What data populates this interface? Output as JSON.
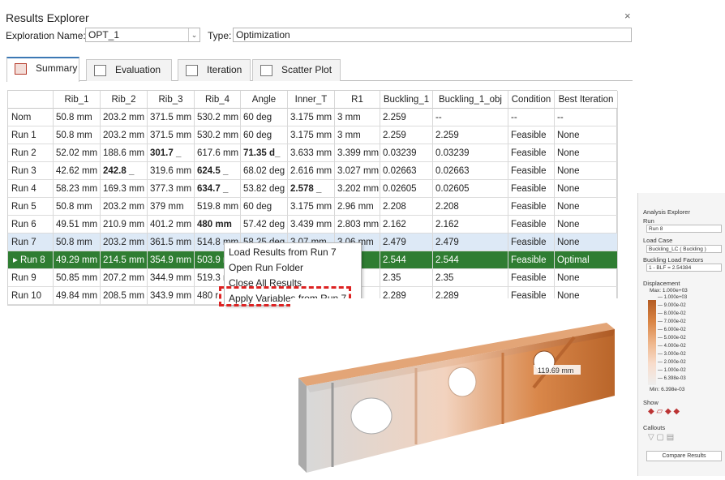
{
  "window": {
    "title": "Results Explorer",
    "close": "×",
    "exploration_label": "Exploration Name:",
    "exploration_value": "OPT_1",
    "type_label": "Type:",
    "type_value": "Optimization"
  },
  "tabs": [
    {
      "label": "Summary"
    },
    {
      "label": "Evaluation"
    },
    {
      "label": "Iteration"
    },
    {
      "label": "Scatter Plot"
    }
  ],
  "table": {
    "headers": [
      "Rib_1",
      "Rib_2",
      "Rib_3",
      "Rib_4",
      "Angle",
      "Inner_T",
      "R1",
      "Buckling_1",
      "Buckling_1_obj",
      "Condition",
      "Best Iteration"
    ],
    "rows": [
      {
        "label": "Nom",
        "cells": [
          "50.8 mm",
          "203.2 mm",
          "371.5 mm",
          "530.2 mm",
          "60 deg",
          "3.175 mm",
          "3 mm",
          "2.259",
          "--",
          "--",
          "--"
        ]
      },
      {
        "label": "Run 1",
        "cells": [
          "50.8 mm",
          "203.2 mm",
          "371.5 mm",
          "530.2 mm",
          "60 deg",
          "3.175 mm",
          "3 mm",
          "2.259",
          "2.259",
          "Feasible",
          "None"
        ]
      },
      {
        "label": "Run 2",
        "cells": [
          "52.02 mm",
          "188.6 mm",
          "301.7 _",
          "617.6 mm",
          "71.35 d_",
          "3.633 mm",
          "3.399 mm",
          "0.03239",
          "0.03239",
          "Feasible",
          "None"
        ]
      },
      {
        "label": "Run 3",
        "cells": [
          "42.62 mm",
          "242.8 _",
          "319.6 mm",
          "624.5 _",
          "68.02 deg",
          "2.616 mm",
          "3.027 mm",
          "0.02663",
          "0.02663",
          "Feasible",
          "None"
        ]
      },
      {
        "label": "Run 4",
        "cells": [
          "58.23 mm",
          "169.3 mm",
          "377.3 mm",
          "634.7 _",
          "53.82 deg",
          "2.578 _",
          "3.202 mm",
          "0.02605",
          "0.02605",
          "Feasible",
          "None"
        ]
      },
      {
        "label": "Run 5",
        "cells": [
          "50.8 mm",
          "203.2 mm",
          "379 mm",
          "519.8 mm",
          "60 deg",
          "3.175 mm",
          "2.96 mm",
          "2.208",
          "2.208",
          "Feasible",
          "None"
        ]
      },
      {
        "label": "Run 6",
        "cells": [
          "49.51 mm",
          "210.9 mm",
          "401.2 mm",
          "480 mm",
          "57.42 deg",
          "3.439 mm",
          "2.803 mm",
          "2.162",
          "2.162",
          "Feasible",
          "None"
        ]
      },
      {
        "label": "Run 7",
        "cells": [
          "50.8 mm",
          "203.2 mm",
          "361.5 mm",
          "514.8 mm",
          "58.25 deg",
          "3.07 mm",
          "3.06 mm",
          "2.479",
          "2.479",
          "Feasible",
          "None"
        ]
      },
      {
        "label": "Run 8",
        "cells": [
          "49.29 mm",
          "214.5 mm",
          "354.9 mm",
          "503.9 r",
          "",
          "",
          "mm",
          "2.544",
          "2.544",
          "Feasible",
          "Optimal"
        ]
      },
      {
        "label": "Run 9",
        "cells": [
          "50.85 mm",
          "207.2 mm",
          "344.9 mm",
          "519.3 r",
          "",
          "",
          "mm",
          "2.35",
          "2.35",
          "Feasible",
          "None"
        ]
      },
      {
        "label": "Run 10",
        "cells": [
          "49.84 mm",
          "208.5 mm",
          "343.9 mm",
          "480 r",
          "",
          "",
          "mm",
          "2.289",
          "2.289",
          "Feasible",
          "None"
        ]
      }
    ]
  },
  "context_menu": [
    "Load Results from Run 7",
    "Open Run Folder",
    "Close All Results",
    "Apply Variables from Run 7"
  ],
  "model": {
    "callout": "119.69 mm"
  },
  "analysis_explorer": {
    "title": "Analysis Explorer",
    "run_label": "Run",
    "run_value": "Run 8",
    "load_case_label": "Load Case",
    "load_case_value": "Buckling_LC ( Buckling )",
    "blf_label": "Buckling Load Factors",
    "blf_value": "1 - BLF = 2.54384",
    "displacement_label": "Displacement",
    "max": "Max: 1.000e+03",
    "min": "Min: 6.398e-03",
    "levels": [
      "1.000e+03",
      "9.000e-02",
      "8.000e-02",
      "7.000e-02",
      "6.000e-02",
      "5.000e-02",
      "4.000e-02",
      "3.000e-02",
      "2.000e-02",
      "1.000e-02",
      "6.398e-03"
    ],
    "show_label": "Show",
    "callouts_label": "Callouts",
    "compare_label": "Compare Results"
  }
}
